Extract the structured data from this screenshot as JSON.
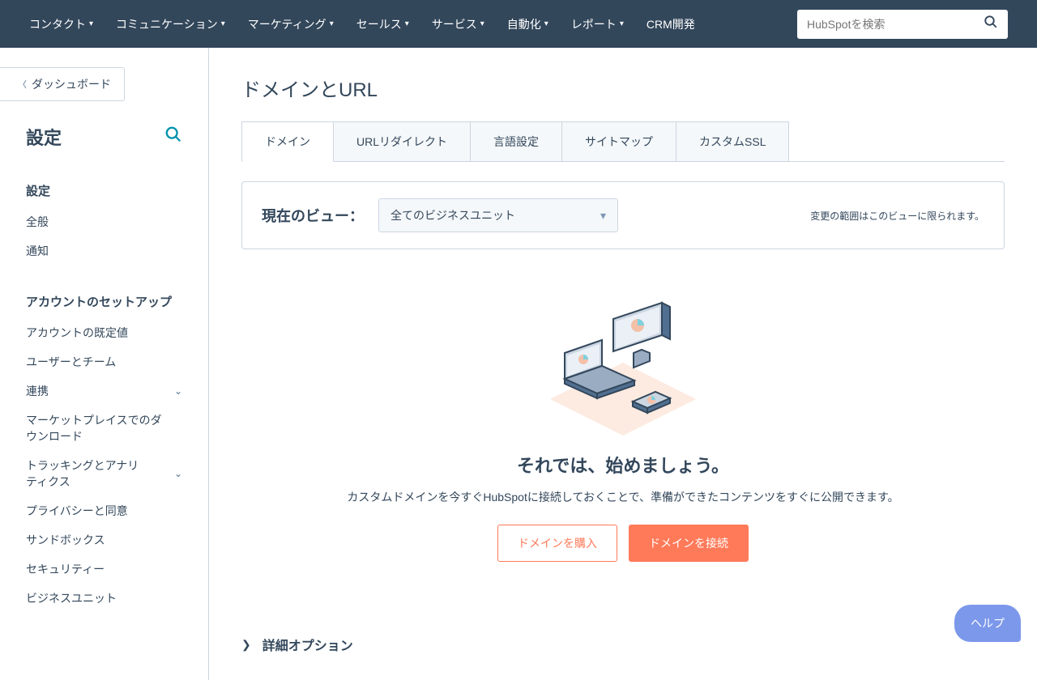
{
  "topnav": {
    "items": [
      "コンタクト",
      "コミュニケーション",
      "マーケティング",
      "セールス",
      "サービス",
      "自動化",
      "レポート"
    ],
    "cta": "CRM開発",
    "search_placeholder": "HubSpotを検索"
  },
  "sidebar": {
    "back": "ダッシュボード",
    "title": "設定",
    "section1_title": "設定",
    "section1": [
      "全般",
      "通知"
    ],
    "section2_title": "アカウントのセットアップ",
    "section2": [
      {
        "label": "アカウントの既定値",
        "chev": false
      },
      {
        "label": "ユーザーとチーム",
        "chev": false
      },
      {
        "label": "連携",
        "chev": true
      },
      {
        "label": "マーケットプレイスでのダウンロード",
        "chev": false
      },
      {
        "label": "トラッキングとアナリティクス",
        "chev": true
      },
      {
        "label": "プライバシーと同意",
        "chev": false
      },
      {
        "label": "サンドボックス",
        "chev": false
      },
      {
        "label": "セキュリティー",
        "chev": false
      },
      {
        "label": "ビジネスユニット",
        "chev": false
      }
    ]
  },
  "page": {
    "title": "ドメインとURL",
    "tabs": [
      "ドメイン",
      "URLリダイレクト",
      "言語設定",
      "サイトマップ",
      "カスタムSSL"
    ],
    "view_label": "現在のビュー：",
    "view_value": "全てのビジネスユニット",
    "view_note": "変更の範囲はこのビューに限られます。"
  },
  "empty": {
    "title": "それでは、始めましょう。",
    "desc": "カスタムドメインを今すぐHubSpotに接続しておくことで、準備ができたコンテンツをすぐに公開できます。",
    "btn_buy": "ドメインを購入",
    "btn_connect": "ドメインを接続"
  },
  "details_label": "詳細オプション",
  "help_label": "ヘルプ"
}
